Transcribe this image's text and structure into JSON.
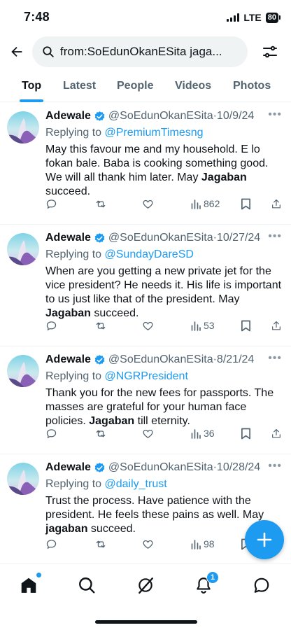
{
  "status_bar": {
    "time": "7:48",
    "network": "LTE",
    "battery": "80"
  },
  "search": {
    "query": "from:SoEdunOkanESita jaga..."
  },
  "tabs": [
    {
      "label": "Top",
      "active": true
    },
    {
      "label": "Latest",
      "active": false
    },
    {
      "label": "People",
      "active": false
    },
    {
      "label": "Videos",
      "active": false
    },
    {
      "label": "Photos",
      "active": false
    }
  ],
  "tweets": [
    {
      "author": "Adewale",
      "handle": "@SoEdunOkanESita",
      "date": "10/9/24",
      "replying_label": "Replying to",
      "replying_to": "@PremiumTimesng",
      "text_parts": [
        "May this favour me and my household. E lo fokan bale. Baba is cooking something good. We will all thank him later. May ",
        "Jagaban",
        " succeed."
      ],
      "views": "862"
    },
    {
      "author": "Adewale",
      "handle": "@SoEdunOkanESita",
      "date": "10/27/24",
      "replying_label": "Replying to",
      "replying_to": "@SundayDareSD",
      "text_parts": [
        "When are you getting a new private jet for the vice president? He needs it. His life is important to us just like that of the president. May ",
        "Jagaban",
        " succeed."
      ],
      "views": "53"
    },
    {
      "author": "Adewale",
      "handle": "@SoEdunOkanESita",
      "date": "8/21/24",
      "replying_label": "Replying to",
      "replying_to": "@NGRPresident",
      "text_parts": [
        "Thank you for the new fees for passports. The masses are grateful for your human face policies. ",
        "Jagaban",
        " till eternity."
      ],
      "views": "36"
    },
    {
      "author": "Adewale",
      "handle": "@SoEdunOkanESita",
      "date": "10/28/24",
      "replying_label": "Replying to",
      "replying_to": "@daily_trust",
      "text_parts": [
        "Trust the process. Have patience with the president. He feels these pains as well. May ",
        "jagaban",
        " succeed."
      ],
      "views": "98"
    }
  ],
  "bottom_nav": {
    "notifications_count": "1"
  },
  "colors": {
    "accent": "#1d9bf0",
    "text": "#0f1419",
    "muted": "#536471",
    "search_bg": "#eff3f4"
  }
}
